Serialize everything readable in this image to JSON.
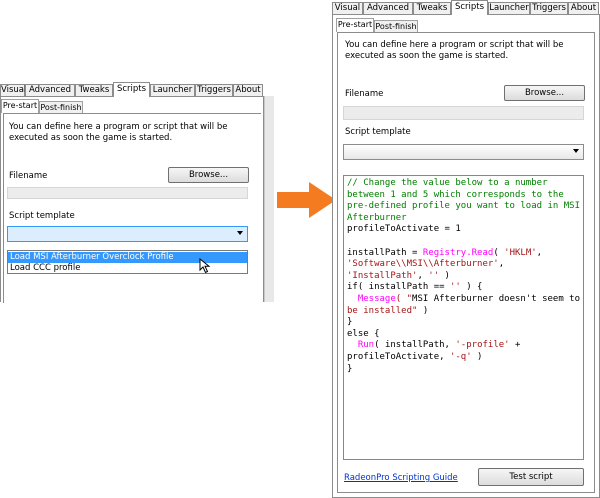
{
  "tabs": [
    "Visual",
    "Advanced",
    "Tweaks",
    "Scripts",
    "Launcher",
    "Triggers",
    "About"
  ],
  "subtabs": [
    "Pre-start",
    "Post-finish"
  ],
  "description": "You can define here a program or script that will be executed as soon the game is started.",
  "filename_label": "Filename",
  "browse_label": "Browse...",
  "filename_value": "",
  "template_label": "Script template",
  "template_selected": "",
  "dropdown_options": [
    "Load MSI Afterburner Overclock Profile",
    "Load CCC profile"
  ],
  "code_lines": [
    "// Change the value below to a number",
    "between 1 and 5 which corresponds to the",
    "pre-defined profile you want to load in MSI",
    "Afterburner",
    "profileToActivate = 1",
    "",
    "installPath = Registry.Read( 'HKLM',",
    "'Software\\\\MSI\\\\Afterburner',",
    "'InstallPath', '' )",
    "if( installPath == '' ) {",
    "  Message( \"MSI Afterburner doesn't seem to",
    "be installed\" )",
    "}",
    "else {",
    "  Run( installPath, '-profile' +",
    "profileToActivate, '-q' )",
    "}"
  ],
  "guide_link": "RadeonPro Scripting Guide",
  "test_button": "Test script",
  "colors": {
    "arrow": "#f47b20",
    "selection": "#3399ff",
    "comment": "#008000",
    "keyword_fn": "#ff00ff",
    "string": "#a31515"
  }
}
